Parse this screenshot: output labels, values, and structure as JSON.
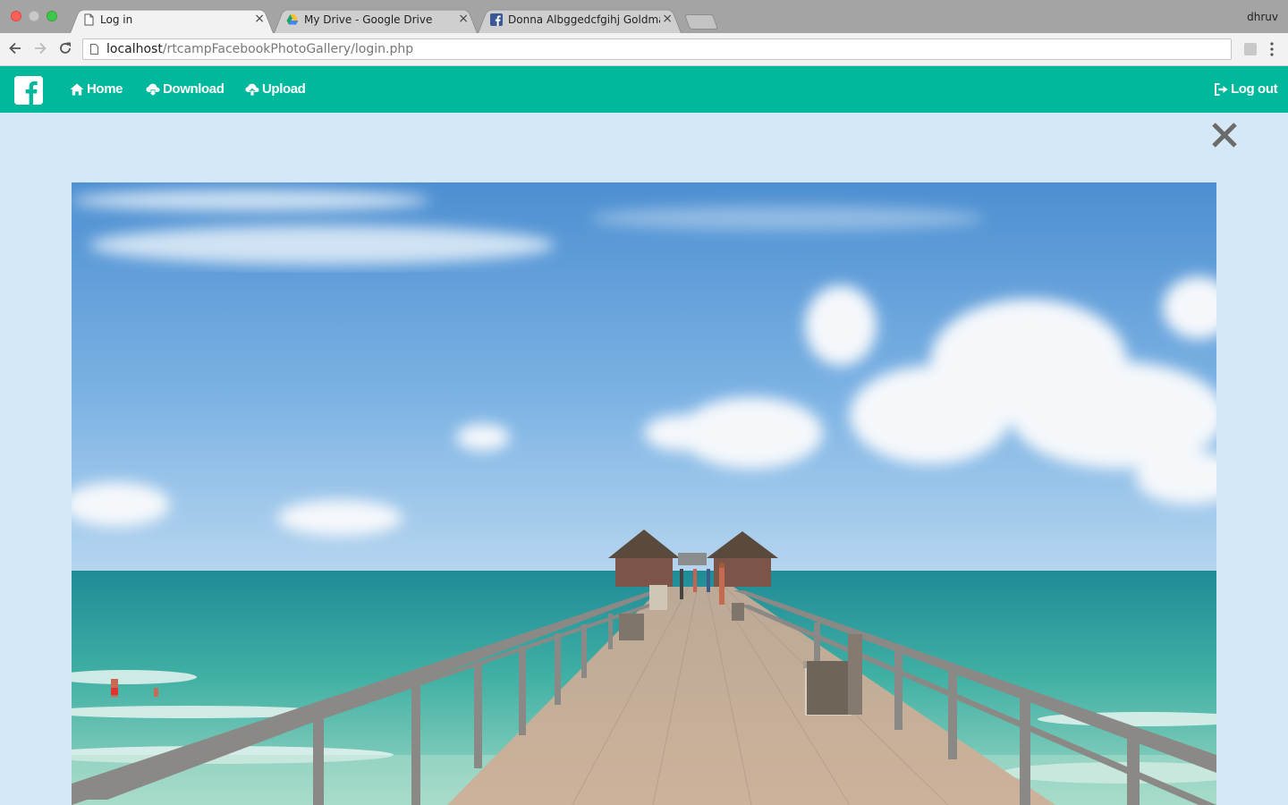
{
  "browser": {
    "tabs": [
      {
        "title": "Log in",
        "favicon": "page-icon",
        "active": true
      },
      {
        "title": "My Drive - Google Drive",
        "favicon": "google-drive-icon",
        "active": false
      },
      {
        "title": "Donna Albggedcfgihj Goldman",
        "favicon": "facebook-icon",
        "active": false
      }
    ],
    "close_glyph": "×",
    "profile_name": "dhruv",
    "url_host": "localhost",
    "url_path": "/rtcampFacebookPhotoGallery/login.php"
  },
  "navbar": {
    "brand_icon": "facebook-icon",
    "home": "Home",
    "download": "Download",
    "upload": "Upload",
    "logout": "Log out"
  },
  "viewer": {
    "close_icon": "close-icon",
    "photo_subject": "pier-beach-photo"
  },
  "colors": {
    "navbar": "#00b89c",
    "page_background": "#d5e8f7",
    "tabbar": "#a4a4a4"
  }
}
